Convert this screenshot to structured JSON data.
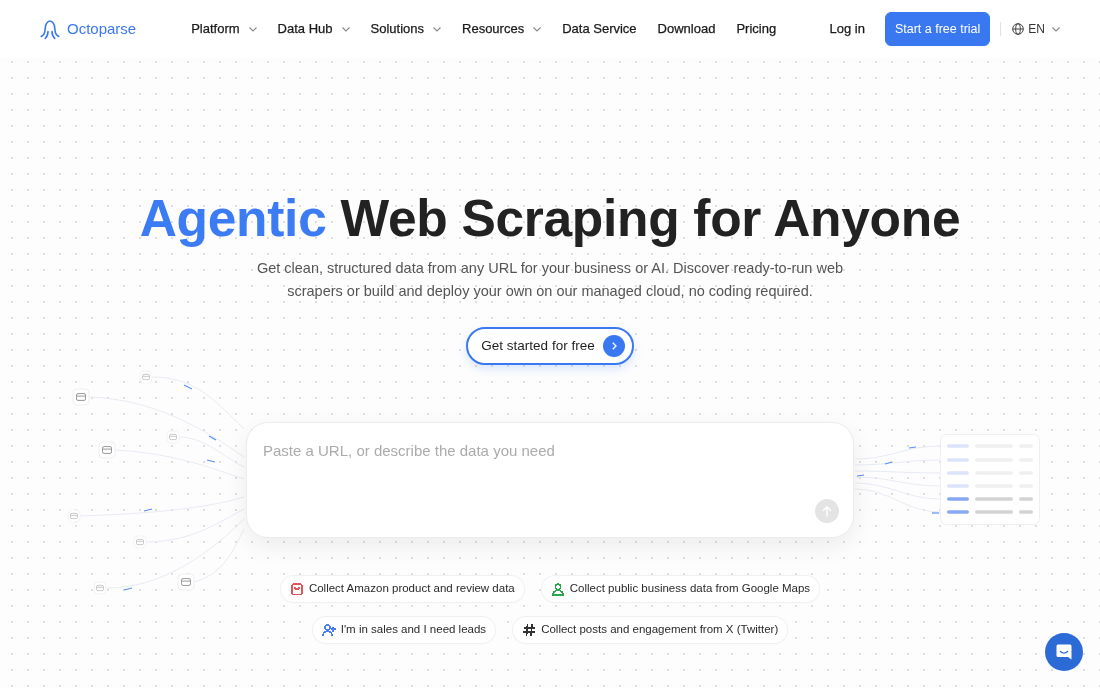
{
  "header": {
    "logo": "Octoparse",
    "nav": [
      {
        "label": "Platform",
        "dropdown": true
      },
      {
        "label": "Data Hub",
        "dropdown": true
      },
      {
        "label": "Solutions",
        "dropdown": true
      },
      {
        "label": "Resources",
        "dropdown": true
      },
      {
        "label": "Data Service",
        "dropdown": false
      },
      {
        "label": "Download",
        "dropdown": false
      },
      {
        "label": "Pricing",
        "dropdown": false
      }
    ],
    "login": "Log in",
    "trial_button": "Start a free trial",
    "language": "EN"
  },
  "hero": {
    "title": [
      {
        "text": "Agentic",
        "highlight": true
      },
      {
        "text": "Web Scraping for Anyone",
        "highlight": false
      }
    ],
    "subtitle": "Get clean, structured data from any URL for your business or AI. Discover ready-to-run web scrapers or build and deploy your own on our managed cloud, no coding required.",
    "button": "Get started for free"
  },
  "prompt": {
    "placeholder": "Paste a URL, or describe the data you need"
  },
  "suggestions": [
    {
      "label": "Collect Amazon product and review data",
      "color": "#e0555a"
    },
    {
      "label": "Collect public business data from Google Maps",
      "color": "#2da44e"
    },
    {
      "label": "I'm in sales and I need leads",
      "color": "#4a7ff5"
    },
    {
      "label": "Collect posts and engagement from X (Twitter)",
      "color": "#333333"
    }
  ]
}
